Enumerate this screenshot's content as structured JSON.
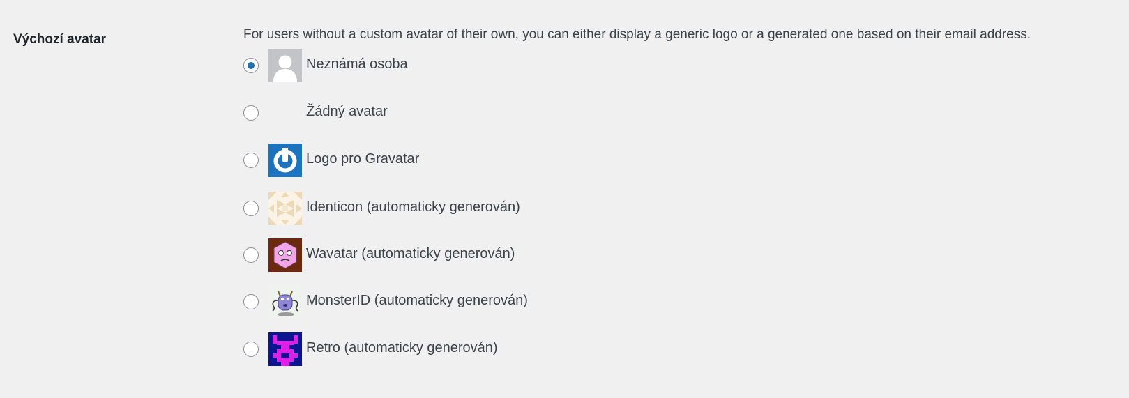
{
  "setting": {
    "label": "Výchozí avatar",
    "description": "For users without a custom avatar of their own, you can either display a generic logo or a generated one based on their email address."
  },
  "options": [
    {
      "label": "Neznámá osoba",
      "checked": true,
      "icon": "mystery-person-icon"
    },
    {
      "label": "Žádný avatar",
      "checked": false,
      "icon": "none"
    },
    {
      "label": "Logo pro Gravatar",
      "checked": false,
      "icon": "gravatar-logo-icon"
    },
    {
      "label": "Identicon (automaticky generován)",
      "checked": false,
      "icon": "identicon-icon"
    },
    {
      "label": "Wavatar (automaticky generován)",
      "checked": false,
      "icon": "wavatar-icon"
    },
    {
      "label": "MonsterID (automaticky generován)",
      "checked": false,
      "icon": "monsterid-icon"
    },
    {
      "label": "Retro (automaticky generován)",
      "checked": false,
      "icon": "retro-icon"
    }
  ],
  "colors": {
    "accent": "#2271b1",
    "background": "#f0f0f1",
    "text": "#3c434a"
  }
}
